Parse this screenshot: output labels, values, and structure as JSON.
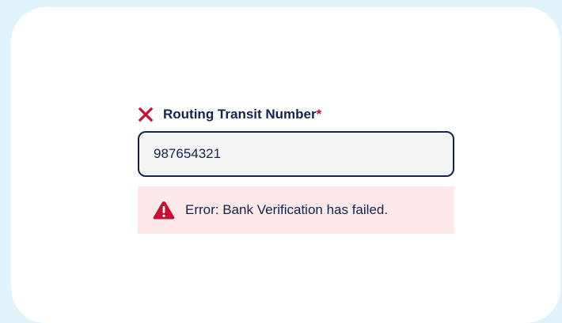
{
  "field": {
    "label": "Routing Transit Number",
    "required_marker": "*",
    "value": "987654321",
    "status_icon": "x-icon"
  },
  "error": {
    "icon": "warning-triangle-icon",
    "message": "Error: Bank Verification has failed."
  },
  "colors": {
    "background": "#dff3fb",
    "card": "#ffffff",
    "text": "#13224f",
    "error_red": "#c8102e",
    "error_bg": "#fde8ea",
    "input_bg": "#f4f4f4"
  }
}
